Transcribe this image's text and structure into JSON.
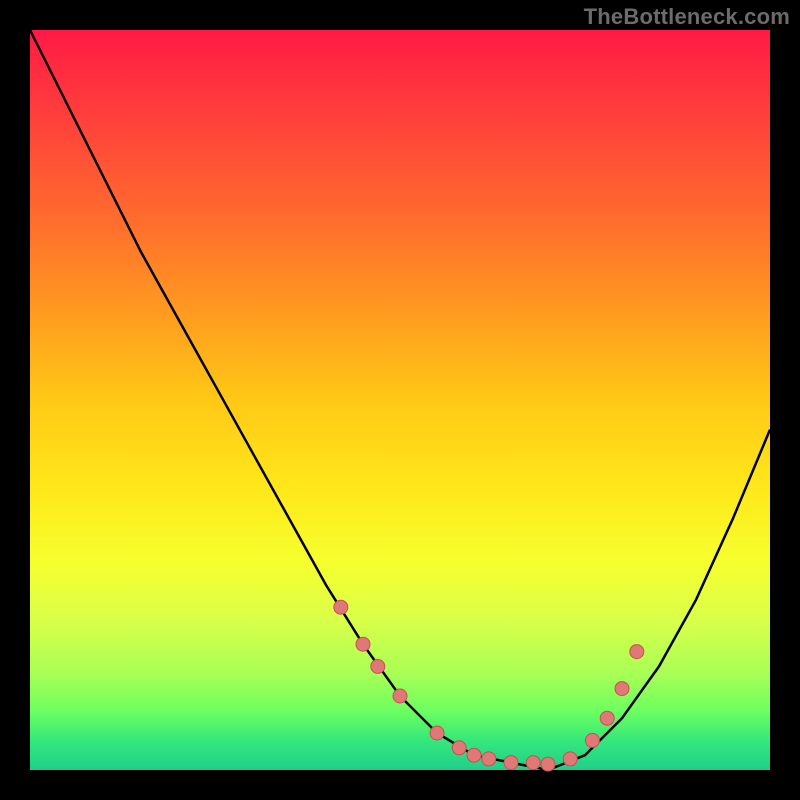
{
  "watermark": "TheBottleneck.com",
  "colors": {
    "background": "#000000",
    "gradient_top": "#ff1a45",
    "gradient_mid": "#ffe81a",
    "gradient_bottom": "#1fcf8a",
    "curve": "#000000",
    "marker_fill": "#e07878",
    "marker_stroke": "#c94f4f"
  },
  "chart_data": {
    "type": "line",
    "title": "",
    "xlabel": "",
    "ylabel": "",
    "x": [
      0.0,
      0.05,
      0.1,
      0.15,
      0.2,
      0.25,
      0.3,
      0.35,
      0.4,
      0.45,
      0.5,
      0.55,
      0.6,
      0.65,
      0.7,
      0.75,
      0.8,
      0.85,
      0.9,
      0.95,
      1.0
    ],
    "y": [
      100,
      90,
      80,
      70,
      61,
      52,
      43,
      34,
      25,
      17,
      10,
      5,
      2,
      1,
      0,
      2,
      7,
      14,
      23,
      34,
      46
    ],
    "xlim": [
      0,
      1
    ],
    "ylim": [
      0,
      100
    ],
    "markers": {
      "x": [
        0.42,
        0.45,
        0.47,
        0.5,
        0.55,
        0.58,
        0.6,
        0.62,
        0.65,
        0.68,
        0.7,
        0.73,
        0.76,
        0.78,
        0.8,
        0.82
      ],
      "y": [
        22,
        17,
        14,
        10,
        5,
        3,
        2,
        1.5,
        1,
        1,
        0.8,
        1.5,
        4,
        7,
        11,
        16
      ]
    }
  }
}
